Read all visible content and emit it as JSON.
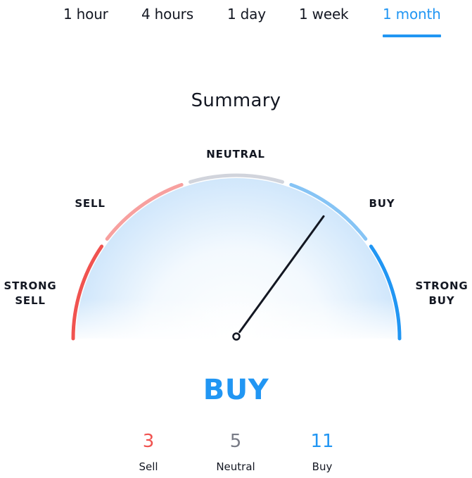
{
  "tabs": [
    {
      "label": "1 hour",
      "active": false
    },
    {
      "label": "4 hours",
      "active": false
    },
    {
      "label": "1 day",
      "active": false
    },
    {
      "label": "1 week",
      "active": false
    },
    {
      "label": "1 month",
      "active": true
    }
  ],
  "summary": {
    "title": "Summary",
    "verdict": "BUY",
    "needle_value": 0.7
  },
  "gauge": {
    "segments": [
      {
        "label": "STRONG SELL",
        "line1": "STRONG",
        "line2": "SELL",
        "color": "#f05350"
      },
      {
        "label": "SELL",
        "line1": "SELL",
        "line2": "",
        "color": "#f7a09f"
      },
      {
        "label": "NEUTRAL",
        "line1": "NEUTRAL",
        "line2": "",
        "color": "#d1d4dc"
      },
      {
        "label": "BUY",
        "line1": "BUY",
        "line2": "",
        "color": "#86c4f5"
      },
      {
        "label": "STRONG BUY",
        "line1": "STRONG",
        "line2": "BUY",
        "color": "#2196f3"
      }
    ]
  },
  "counts": [
    {
      "label": "Sell",
      "value": "3",
      "color": "#f05350"
    },
    {
      "label": "Neutral",
      "value": "5",
      "color": "#787b86"
    },
    {
      "label": "Buy",
      "value": "11",
      "color": "#2196f3"
    }
  ],
  "colors": {
    "accent": "#2196f3",
    "text": "#131722",
    "needle": "#131722"
  }
}
